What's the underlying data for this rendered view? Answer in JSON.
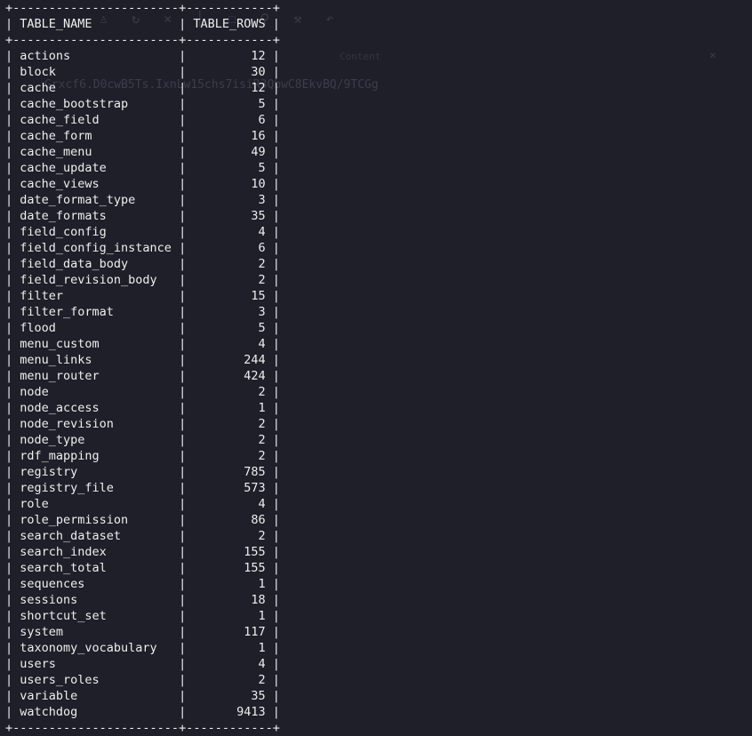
{
  "background_ghost": {
    "hash_text": "Grxcf6.D0cwB5Ts.IxnLw15chs7isiR3QbwC8EkvBQ/9TCGg",
    "panel_title": "Content"
  },
  "table": {
    "columns": [
      "TABLE_NAME",
      "TABLE_ROWS"
    ],
    "rows": [
      [
        "actions",
        "12"
      ],
      [
        "block",
        "30"
      ],
      [
        "cache",
        "12"
      ],
      [
        "cache_bootstrap",
        "5"
      ],
      [
        "cache_field",
        "6"
      ],
      [
        "cache_form",
        "16"
      ],
      [
        "cache_menu",
        "49"
      ],
      [
        "cache_update",
        "5"
      ],
      [
        "cache_views",
        "10"
      ],
      [
        "date_format_type",
        "3"
      ],
      [
        "date_formats",
        "35"
      ],
      [
        "field_config",
        "4"
      ],
      [
        "field_config_instance",
        "6"
      ],
      [
        "field_data_body",
        "2"
      ],
      [
        "field_revision_body",
        "2"
      ],
      [
        "filter",
        "15"
      ],
      [
        "filter_format",
        "3"
      ],
      [
        "flood",
        "5"
      ],
      [
        "menu_custom",
        "4"
      ],
      [
        "menu_links",
        "244"
      ],
      [
        "menu_router",
        "424"
      ],
      [
        "node",
        "2"
      ],
      [
        "node_access",
        "1"
      ],
      [
        "node_revision",
        "2"
      ],
      [
        "node_type",
        "2"
      ],
      [
        "rdf_mapping",
        "2"
      ],
      [
        "registry",
        "785"
      ],
      [
        "registry_file",
        "573"
      ],
      [
        "role",
        "4"
      ],
      [
        "role_permission",
        "86"
      ],
      [
        "search_dataset",
        "2"
      ],
      [
        "search_index",
        "155"
      ],
      [
        "search_total",
        "155"
      ],
      [
        "sequences",
        "1"
      ],
      [
        "sessions",
        "18"
      ],
      [
        "shortcut_set",
        "1"
      ],
      [
        "system",
        "117"
      ],
      [
        "taxonomy_vocabulary",
        "1"
      ],
      [
        "users",
        "4"
      ],
      [
        "users_roles",
        "2"
      ],
      [
        "variable",
        "35"
      ],
      [
        "watchdog",
        "9413"
      ]
    ]
  }
}
